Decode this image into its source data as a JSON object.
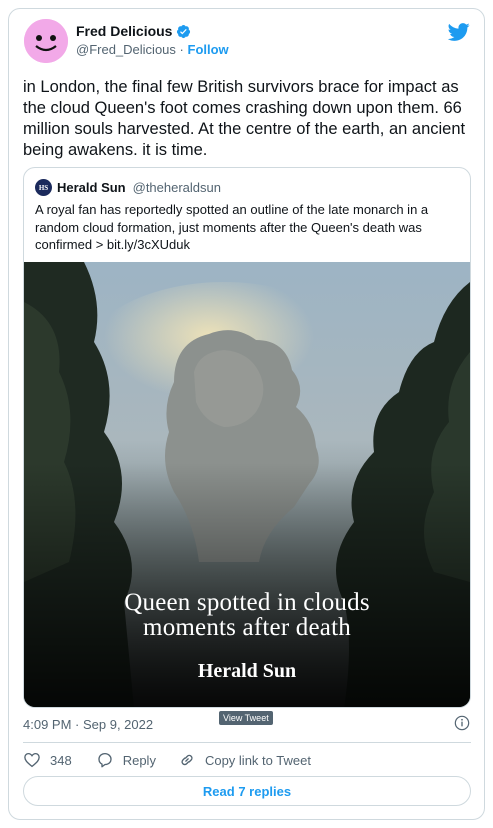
{
  "author": {
    "name": "Fred Delicious",
    "handle": "@Fred_Delicious",
    "separator": "·",
    "follow_label": "Follow",
    "avatar_color": "#f2a9e8"
  },
  "tweet": {
    "text": "in London, the final few British survivors brace for impact as the cloud Queen's foot comes crashing down upon them. 66 million souls harvested. At the centre of the earth, an ancient being awakens. it is time.",
    "timestamp": "4:09 PM · Sep 9, 2022",
    "tooltip": "View Tweet"
  },
  "quoted": {
    "logo_text": "HS",
    "name": "Herald Sun",
    "handle": "@theheraldsun",
    "text": "A royal fan has reportedly spotted an outline of the late monarch in a random cloud formation, just moments after the Queen's death was confirmed > bit.ly/3cXUduk",
    "image_headline_line1": "Queen spotted in clouds",
    "image_headline_line2": "moments after death",
    "image_brand": "Herald Sun"
  },
  "actions": {
    "like_count": "348",
    "reply_label": "Reply",
    "copy_label": "Copy link to Tweet"
  },
  "footer": {
    "read_replies_label": "Read 7 replies"
  },
  "colors": {
    "accent": "#1d9bf0",
    "text": "#0f1419",
    "secondary": "#536471",
    "border": "#cfd9de"
  }
}
